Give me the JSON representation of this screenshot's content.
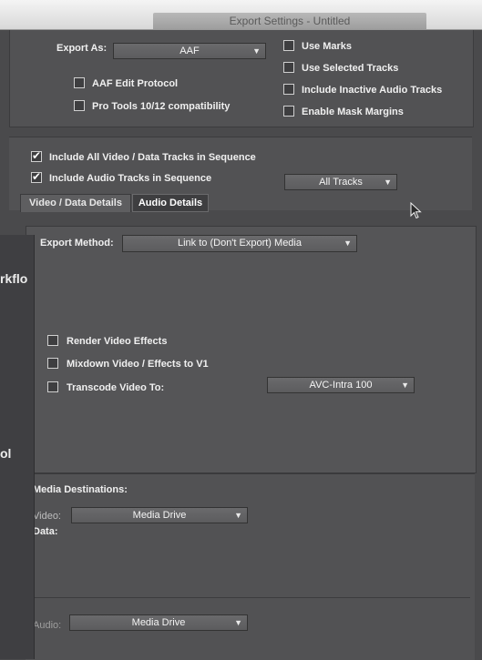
{
  "window": {
    "title": "Export Settings - Untitled"
  },
  "export_as": {
    "label": "Export As:",
    "value": "AAF"
  },
  "options_left": [
    {
      "label": "AAF Edit Protocol",
      "checked": false
    },
    {
      "label": "Pro Tools 10/12 compatibility",
      "checked": false
    }
  ],
  "options_right": [
    {
      "label": "Use Marks",
      "checked": false
    },
    {
      "label": "Use Selected Tracks",
      "checked": false
    },
    {
      "label": "Include Inactive Audio Tracks",
      "checked": false
    },
    {
      "label": "Enable Mask Margins",
      "checked": false
    }
  ],
  "include_video": {
    "label": "Include All Video / Data Tracks in Sequence",
    "checked": true
  },
  "include_audio": {
    "label": "Include Audio Tracks in Sequence",
    "checked": true
  },
  "audio_tracks_select": {
    "value": "All Tracks"
  },
  "tabs": [
    {
      "label": "Video / Data Details",
      "active": true
    },
    {
      "label": "Audio Details",
      "active": false
    }
  ],
  "export_method": {
    "label": "Export Method:",
    "value": "Link to (Don't Export) Media"
  },
  "video_options": [
    {
      "label": "Render Video Effects",
      "checked": false
    },
    {
      "label": "Mixdown Video / Effects to V1",
      "checked": false
    },
    {
      "label": "Transcode Video To:",
      "checked": false
    }
  ],
  "transcode_select": {
    "value": "AVC-Intra 100"
  },
  "media_destinations": {
    "heading": "Media Destinations:",
    "video_label": "Video:",
    "video_value": "Media Drive",
    "data_label": "Data:",
    "audio_label": "Audio:",
    "audio_value": "Media Drive"
  },
  "background_window": {
    "text_top": "rkflo",
    "text_bottom": "ol"
  },
  "icons": {
    "dropdown": "chevron-down-icon",
    "check": "check-icon",
    "cursor": "mouse-pointer-icon"
  },
  "colors": {
    "panel": "#525254",
    "background": "#4a4a4c",
    "text": "#f0f0f0"
  }
}
